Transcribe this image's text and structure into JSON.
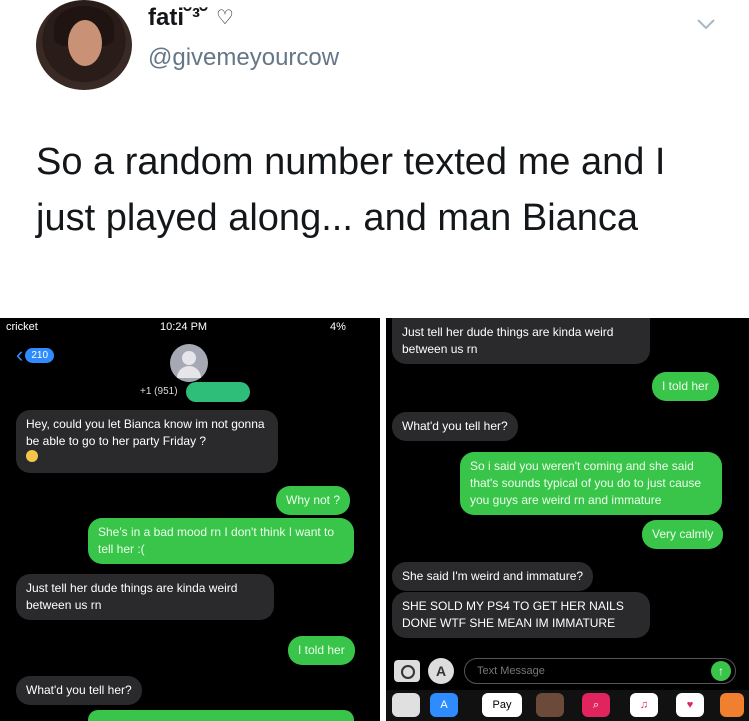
{
  "tweet": {
    "display_name": "fati˘³˘",
    "handle": "@givemeyourcow",
    "text": "So a random number texted me and I just played along... and man Bianca"
  },
  "left_screenshot": {
    "status": {
      "carrier": "cricket",
      "time": "10:24 PM",
      "battery": "4%"
    },
    "back_badge": "210",
    "contact_number": "+1 (951)",
    "messages": [
      {
        "dir": "received",
        "text": "Hey, could you let Bianca know im not gonna be able to go to her party Friday ?"
      },
      {
        "dir": "sent",
        "text": "Why not ?"
      },
      {
        "dir": "sent",
        "text": "She's in a bad mood rn I don't think I want to tell her :("
      },
      {
        "dir": "received",
        "text": "Just tell her dude things are kinda weird between us rn"
      },
      {
        "dir": "sent",
        "text": "I told her"
      },
      {
        "dir": "received",
        "text": "What'd you tell her?"
      }
    ]
  },
  "right_screenshot": {
    "messages": [
      {
        "dir": "received",
        "text": "Just tell her dude things are kinda weird between us rn"
      },
      {
        "dir": "sent",
        "text": "I told her"
      },
      {
        "dir": "received",
        "text": "What'd you tell her?"
      },
      {
        "dir": "sent",
        "text": "So i said you weren't coming and she said that's sounds typical of you do to just cause you guys are weird rn and immature"
      },
      {
        "dir": "sent",
        "text": "Very calmly"
      },
      {
        "dir": "received",
        "text": "She said I'm weird and immature?"
      },
      {
        "dir": "received",
        "text": "SHE SOLD MY PS4 TO GET HER NAILS DONE WTF SHE MEAN IM IMMATURE"
      }
    ],
    "compose_placeholder": "Text Message",
    "drawer": {
      "pay_label": "Pay"
    }
  },
  "colors": {
    "sent": "#39c54a",
    "received": "#2a2a2c",
    "ios_blue": "#2f8cff"
  }
}
